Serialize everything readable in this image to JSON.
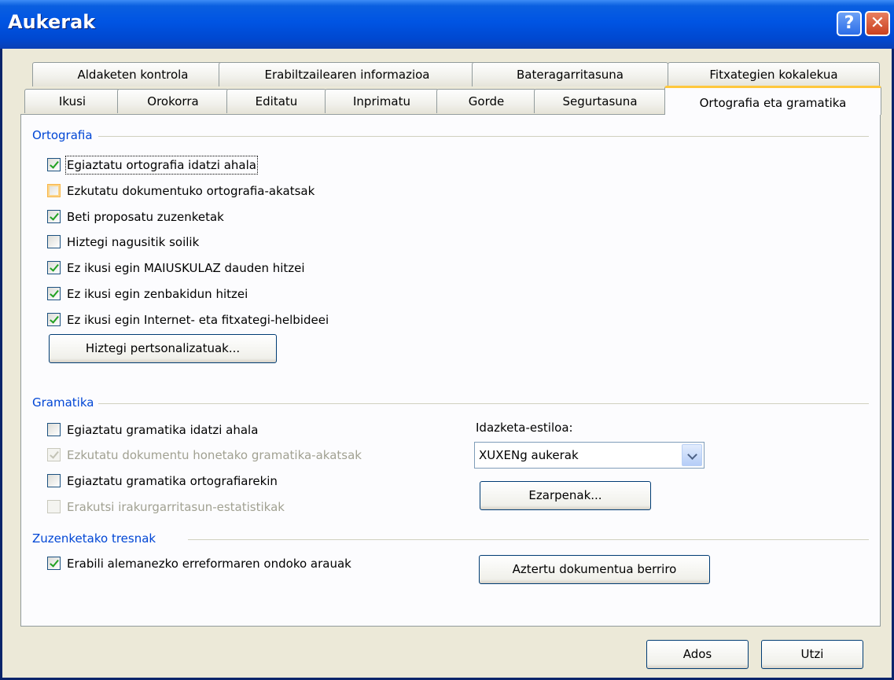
{
  "window": {
    "title": "Aukerak",
    "help_label": "?",
    "close_label": "✕"
  },
  "tabs_back": [
    "Aldaketen kontrola",
    "Erabiltzailearen informazioa",
    "Bateragarritasuna",
    "Fitxategien kokalekua"
  ],
  "tabs_front": [
    "Ikusi",
    "Orokorra",
    "Editatu",
    "Inprimatu",
    "Gorde",
    "Segurtasuna",
    "Ortografia eta gramatika"
  ],
  "active_tab": "Ortografia eta gramatika",
  "ortografia": {
    "title": "Ortografia",
    "options": [
      {
        "label": "Egiaztatu ortografia idatzi ahala",
        "checked": true
      },
      {
        "label": "Ezkutatu dokumentuko ortografia-akatsak",
        "checked": false
      },
      {
        "label": "Beti proposatu zuzenketak",
        "checked": true
      },
      {
        "label": "Hiztegi nagusitik soilik",
        "checked": false
      },
      {
        "label": "Ez ikusi egin MAIUSKULAZ dauden hitzei",
        "checked": true
      },
      {
        "label": "Ez ikusi egin zenbakidun hitzei",
        "checked": true
      },
      {
        "label": "Ez ikusi egin Internet- eta fitxategi-helbideei",
        "checked": true
      }
    ],
    "custom_dict_button": "Hiztegi pertsonalizatuak..."
  },
  "gramatika": {
    "title": "Gramatika",
    "options": [
      {
        "label": "Egiaztatu gramatika idatzi ahala",
        "checked": false,
        "enabled": true
      },
      {
        "label": "Ezkutatu dokumentu honetako gramatika-akatsak",
        "checked": true,
        "enabled": false
      },
      {
        "label": "Egiaztatu gramatika ortografiarekin",
        "checked": false,
        "enabled": true
      },
      {
        "label": "Erakutsi irakurgarritasun-estatistikak",
        "checked": false,
        "enabled": false
      }
    ],
    "style_label": "Idazketa-estiloa:",
    "style_value": "XUXENg aukerak",
    "settings_button": "Ezarpenak..."
  },
  "tresnak": {
    "title": "Zuzenketako tresnak",
    "options": [
      {
        "label": "Erabili alemanezko erreformaren ondoko arauak",
        "checked": true
      }
    ],
    "recheck_button": "Aztertu dokumentua berriro"
  },
  "footer": {
    "ok_label": "Ados",
    "cancel_label": "Utzi"
  }
}
